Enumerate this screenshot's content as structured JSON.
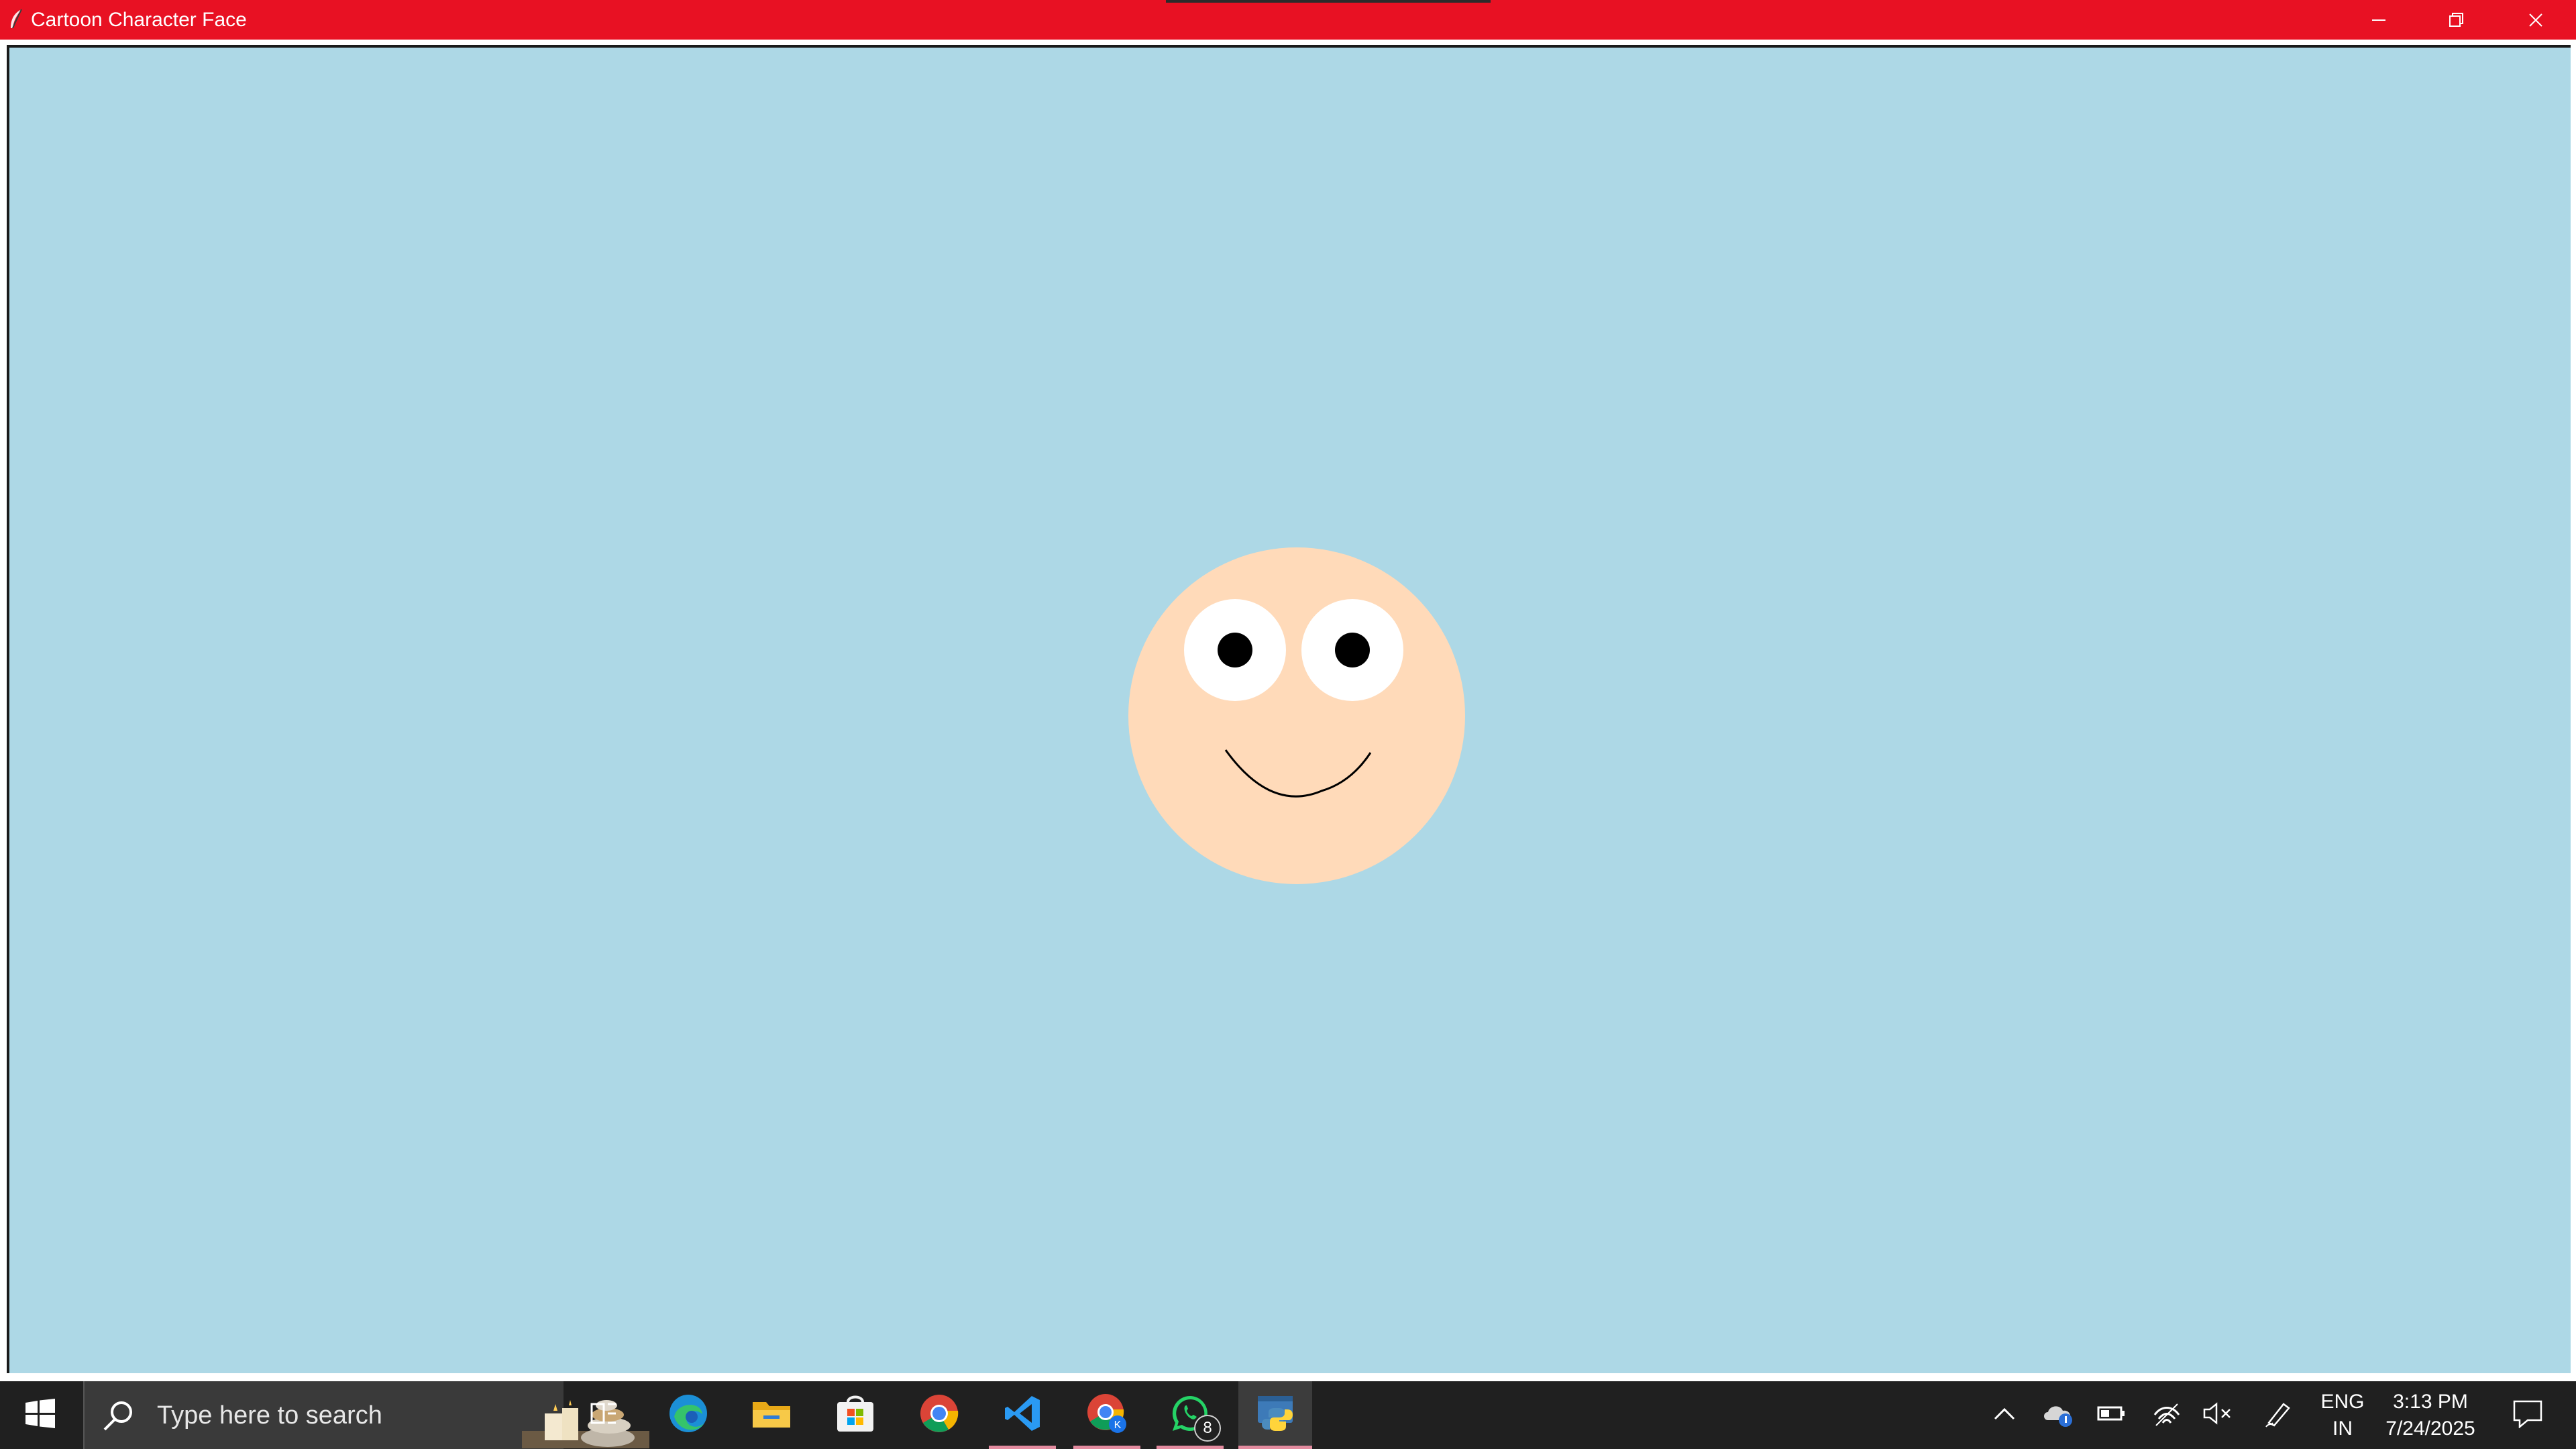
{
  "window": {
    "title": "Cartoon Character Face",
    "controls": {
      "minimize_icon": "minimize-icon",
      "restore_icon": "restore-icon",
      "close_icon": "close-icon"
    }
  },
  "colors": {
    "titlebar": "#e81123",
    "canvas_background": "#add8e6",
    "face_skin": "#ffdab9",
    "eye_white": "#ffffff",
    "pupil": "#000000",
    "mouth": "#000000",
    "taskbar": "#202020"
  },
  "taskbar": {
    "search": {
      "placeholder": "Type here to search"
    },
    "apps": [
      {
        "name": "task-view-icon"
      },
      {
        "name": "edge-icon"
      },
      {
        "name": "file-explorer-icon"
      },
      {
        "name": "microsoft-store-icon"
      },
      {
        "name": "chrome-icon"
      },
      {
        "name": "vscode-icon"
      },
      {
        "name": "chrome-profile-icon"
      },
      {
        "name": "whatsapp-icon",
        "badge": "8"
      },
      {
        "name": "python-icon"
      }
    ],
    "tray": {
      "language_line1": "ENG",
      "language_line2": "IN",
      "time": "3:13 PM",
      "date": "7/24/2025"
    }
  }
}
